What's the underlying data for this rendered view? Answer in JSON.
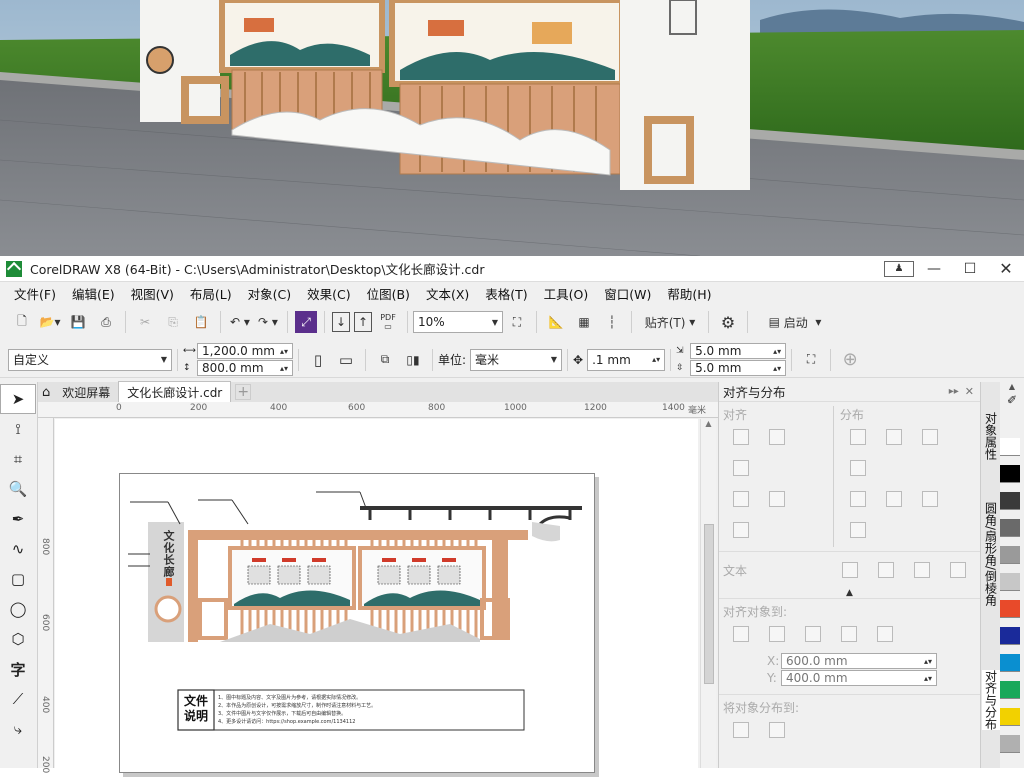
{
  "window": {
    "title": "CorelDRAW X8 (64-Bit) - C:\\Users\\Administrator\\Desktop\\文化长廊设计.cdr",
    "controls": [
      "minimize-icon",
      "maximize-icon",
      "close-icon"
    ]
  },
  "menu": [
    "文件(F)",
    "编辑(E)",
    "视图(V)",
    "布局(L)",
    "对象(C)",
    "效果(C)",
    "位图(B)",
    "文本(X)",
    "表格(T)",
    "工具(O)",
    "窗口(W)",
    "帮助(H)"
  ],
  "toolbar": {
    "zoom": "10%",
    "snap_label": "贴齐(T)",
    "launch_label": "启动",
    "pdf_label": "PDF"
  },
  "property_bar": {
    "preset": "自定义",
    "width": "1,200.0 mm",
    "height": "800.0 mm",
    "units_label": "单位:",
    "units": "毫米",
    "nudge": ".1 mm",
    "dup_x": "5.0 mm",
    "dup_y": "5.0 mm"
  },
  "tabs": [
    "欢迎屏幕",
    "文化长廊设计.cdr"
  ],
  "ruler": {
    "h_ticks": [
      "0",
      "200",
      "400",
      "600",
      "800",
      "1000",
      "1200",
      "1400"
    ],
    "h_unit": "毫米",
    "v_ticks": [
      "800",
      "600",
      "400",
      "200"
    ]
  },
  "docker": {
    "title": "对齐与分布",
    "align_label": "对齐",
    "distribute_label": "分布",
    "text_label": "文本",
    "align_to_label": "对齐对象到:",
    "x_value": "600.0 mm",
    "y_value": "400.0 mm",
    "distribute_to_label": "将对象分布到:",
    "x_letter": "X:",
    "y_letter": "Y:"
  },
  "side_tabs": [
    "对象属性",
    "圆角/扇形角/倒棱角",
    "对齐与分布"
  ],
  "artwork": {
    "title_vertical": "文化长廊",
    "note_title": "文件说明",
    "note_lines": [
      "1、图中标题及内容、文字及图片为参考，请根据实际情况修改。",
      "2、本作品为原创设计，可按需求缩放尺寸，制作时请注意材料与工艺。",
      "3、文件中图片与文字仅作展示，下载后可自由编辑替换。",
      "4、更多设计请访问：https://shop.example.com/1134112"
    ]
  },
  "palette": [
    "#ffffff",
    "#000000",
    "#3a3a3a",
    "#6a6a6a",
    "#9a9a9a",
    "#c7c7c7",
    "#e84a2a",
    "#1a2a9a",
    "#0a8fd0",
    "#19a85a",
    "#f2d100",
    "#b0b0b0"
  ],
  "colors": {
    "accent": "#1e8c38",
    "wood": "#d9a07a",
    "teal": "#2e6d6a",
    "dark": "#333333"
  }
}
